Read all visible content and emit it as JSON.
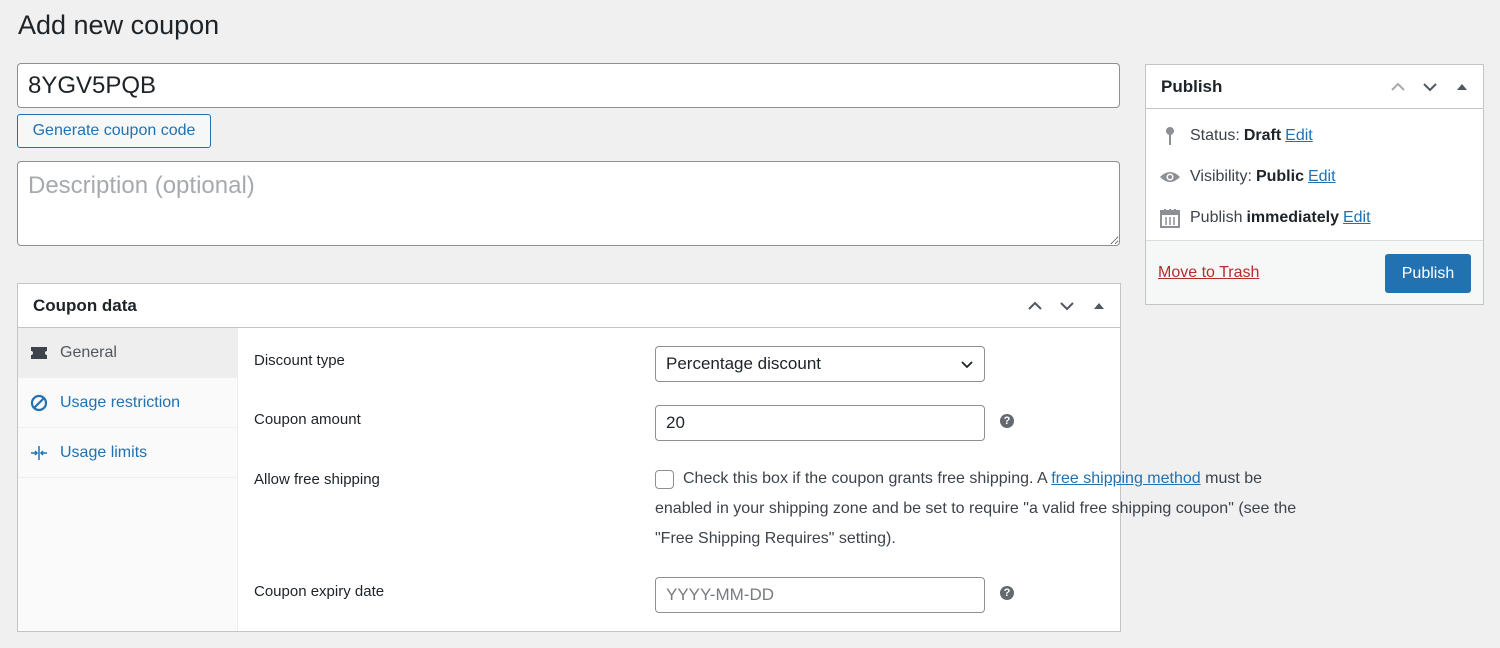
{
  "page_title": "Add new coupon",
  "coupon_code": "8YGV5PQB",
  "generate_label": "Generate coupon code",
  "description_placeholder": "Description (optional)",
  "coupon_data": {
    "title": "Coupon data",
    "tabs": [
      {
        "label": "General",
        "icon": "ticket-icon",
        "active": true
      },
      {
        "label": "Usage restriction",
        "icon": "ban-icon",
        "active": false
      },
      {
        "label": "Usage limits",
        "icon": "limits-icon",
        "active": false
      }
    ],
    "fields": {
      "discount_type_label": "Discount type",
      "discount_type_value": "Percentage discount",
      "amount_label": "Coupon amount",
      "amount_value": "20",
      "free_shipping_label": "Allow free shipping",
      "free_shipping_text_1": "Check this box if the coupon grants free shipping. A",
      "free_shipping_link": "free shipping method",
      "free_shipping_text_2": "must be enabled in your shipping zone and be set to require \"a valid free shipping coupon\" (see the \"Free Shipping Requires\" setting).",
      "free_shipping_checked": false,
      "expiry_label": "Coupon expiry date",
      "expiry_placeholder": "YYYY-MM-DD",
      "help_glyph": "?"
    }
  },
  "publish": {
    "title": "Publish",
    "status_label": "Status:",
    "status_value": "Draft",
    "visibility_label": "Visibility:",
    "visibility_value": "Public",
    "schedule_label": "Publish",
    "schedule_value": "immediately",
    "edit_label": "Edit",
    "trash_label": "Move to Trash",
    "publish_button": "Publish"
  },
  "colors": {
    "accent": "#2271b1",
    "danger": "#b32d2e",
    "background": "#f0f0f1"
  }
}
